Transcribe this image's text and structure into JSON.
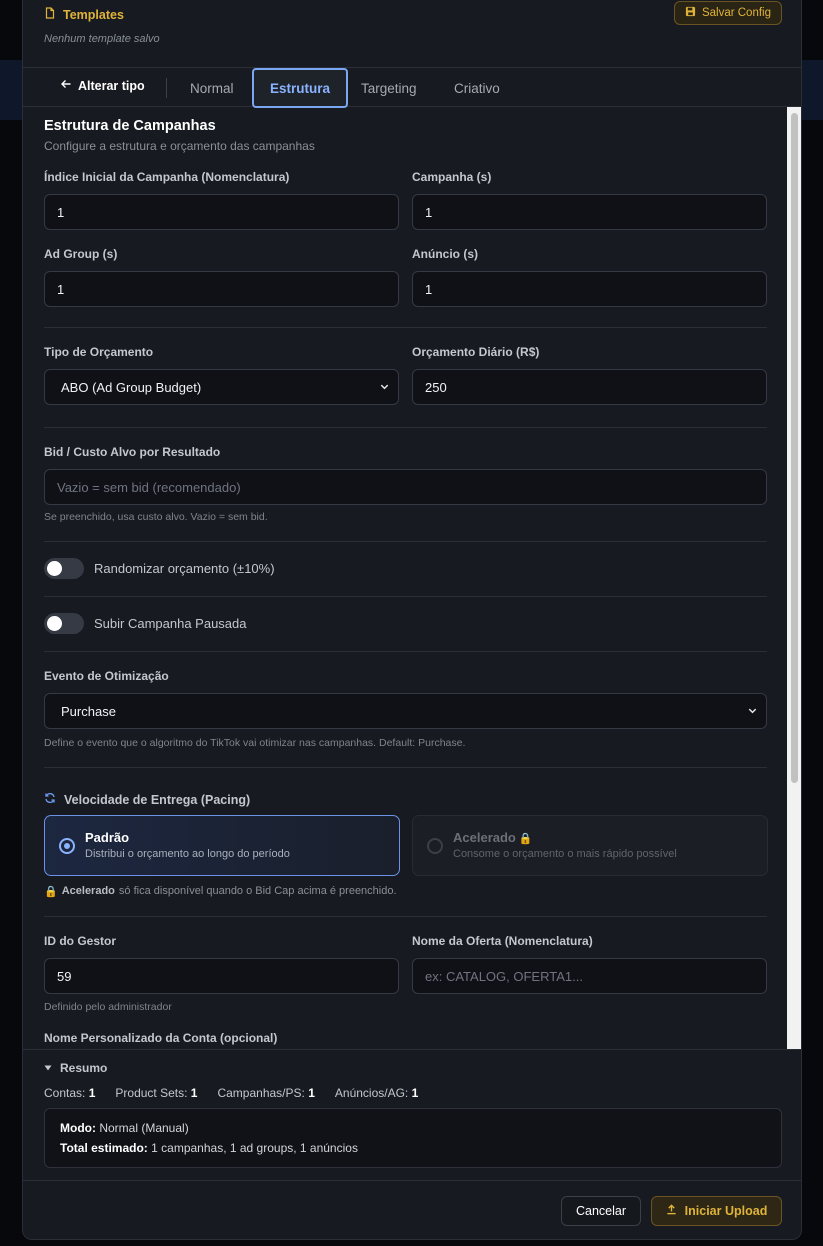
{
  "templates": {
    "title": "Templates",
    "empty_text": "Nenhum template salvo",
    "save_button": "Salvar Config"
  },
  "tabs": {
    "back_label": "Alterar tipo",
    "items": [
      "Normal",
      "Estrutura",
      "Targeting",
      "Criativo"
    ],
    "active": "Estrutura"
  },
  "structure": {
    "title": "Estrutura de Campanhas",
    "subtitle": "Configure a estrutura e orçamento das campanhas",
    "start_index": {
      "label": "Índice Inicial da Campanha (Nomenclatura)",
      "value": "1"
    },
    "campaigns": {
      "label": "Campanha (s)",
      "value": "1"
    },
    "ad_groups": {
      "label": "Ad Group (s)",
      "value": "1"
    },
    "ads": {
      "label": "Anúncio (s)",
      "value": "1"
    },
    "budget_type": {
      "label": "Tipo de Orçamento",
      "value": "ABO (Ad Group Budget)"
    },
    "daily_budget": {
      "label": "Orçamento Diário (R$)",
      "value": "250"
    },
    "bid": {
      "label": "Bid / Custo Alvo por Resultado",
      "placeholder": "Vazio = sem bid (recomendado)",
      "hint": "Se preenchido, usa custo alvo. Vazio = sem bid."
    },
    "randomize": {
      "label": "Randomizar orçamento (±10%)",
      "on": false
    },
    "paused": {
      "label": "Subir Campanha Pausada",
      "on": false
    },
    "optimization_event": {
      "label": "Evento de Otimização",
      "value": "Purchase",
      "hint": "Define o evento que o algoritmo do TikTok vai otimizar nas campanhas. Default: Purchase."
    },
    "pacing": {
      "title": "Velocidade de Entrega (Pacing)",
      "standard": {
        "name": "Padrão",
        "desc": "Distribui o orçamento ao longo do período"
      },
      "accelerated": {
        "name": "Acelerado",
        "desc": "Consome o orçamento o mais rápido possível"
      },
      "note_bold": "Acelerado",
      "note_rest": "só fica disponível quando o Bid Cap acima é preenchido."
    },
    "manager_id": {
      "label": "ID do Gestor",
      "value": "59",
      "hint": "Definido pelo administrador"
    },
    "offer_name": {
      "label": "Nome da Oferta (Nomenclatura)",
      "placeholder": "ex: CATALOG, OFERTA1..."
    },
    "custom_account_name": {
      "label": "Nome Personalizado da Conta (opcional)"
    }
  },
  "summary": {
    "title": "Resumo",
    "stats": [
      {
        "label": "Contas:",
        "value": "1"
      },
      {
        "label": "Product Sets:",
        "value": "1"
      },
      {
        "label": "Campanhas/PS:",
        "value": "1"
      },
      {
        "label": "Anúncios/AG:",
        "value": "1"
      }
    ],
    "mode_label": "Modo:",
    "mode_value": "Normal (Manual)",
    "total_label": "Total estimado:",
    "total_value": "1 campanhas, 1 ad groups, 1 anúncios"
  },
  "footer": {
    "cancel": "Cancelar",
    "upload": "Iniciar Upload"
  },
  "colors": {
    "accent_gold": "#e0b43a",
    "accent_blue": "#8ab4ff",
    "background": "#171a20"
  }
}
